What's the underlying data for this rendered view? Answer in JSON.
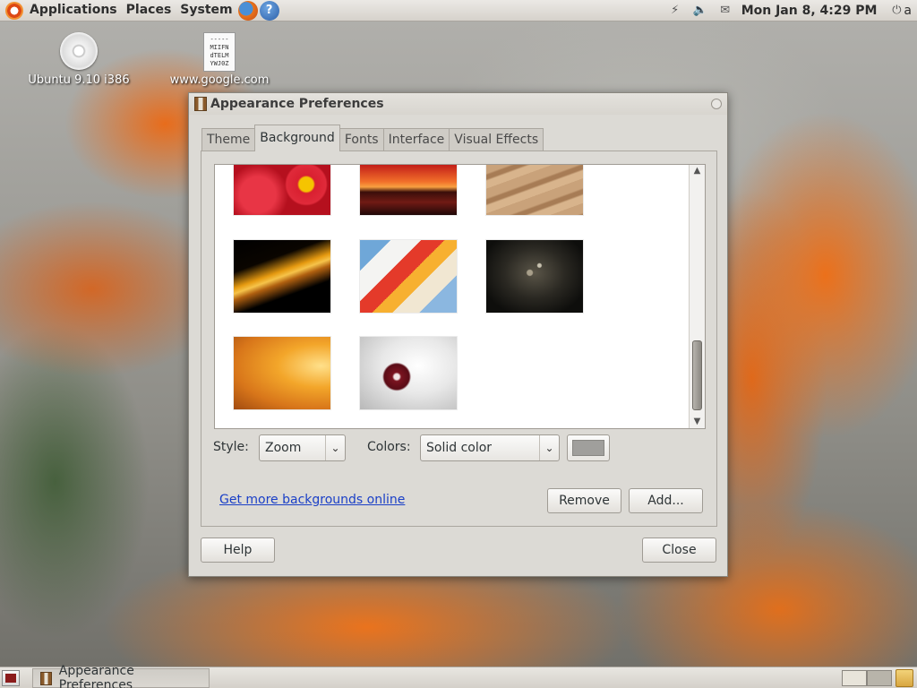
{
  "top_panel": {
    "menus": [
      "Applications",
      "Places",
      "System"
    ],
    "clock": "Mon Jan  8,  4:29 PM",
    "user_initial": "a",
    "icons": [
      "ubuntu-logo-icon",
      "firefox-icon",
      "help-icon",
      "network-icon",
      "volume-icon",
      "mail-icon",
      "power-icon"
    ]
  },
  "desktop": {
    "icons": [
      {
        "label": "Ubuntu 9.10 i386",
        "icon": "cd-icon"
      },
      {
        "label": "www.google.com",
        "icon": "document-icon",
        "preview_text": "-----\nMIIFN\ndTELM\nYWJ0Z"
      }
    ]
  },
  "window": {
    "title": "Appearance Preferences",
    "tabs": [
      {
        "label": "Theme",
        "active": false
      },
      {
        "label": "Background",
        "active": true
      },
      {
        "label": "Fonts",
        "active": false
      },
      {
        "label": "Interface",
        "active": false
      },
      {
        "label": "Visual Effects",
        "active": false
      }
    ],
    "background": {
      "thumbnails": [
        "red-flowers",
        "sunset-water",
        "sand-dunes",
        "dark-orange-streaks",
        "colorful-paper",
        "dark-sparkles",
        "orange-gradient",
        "white-flower"
      ],
      "style_label": "Style:",
      "style_value": "Zoom",
      "colors_label": "Colors:",
      "colors_value": "Solid color",
      "swatch_color": "#a09f9c",
      "link_text": "Get more backgrounds online",
      "remove_label": "Remove",
      "add_label": "Add..."
    },
    "help_label": "Help",
    "close_label": "Close"
  },
  "bottom_panel": {
    "task_label": "Appearance Preferences"
  }
}
